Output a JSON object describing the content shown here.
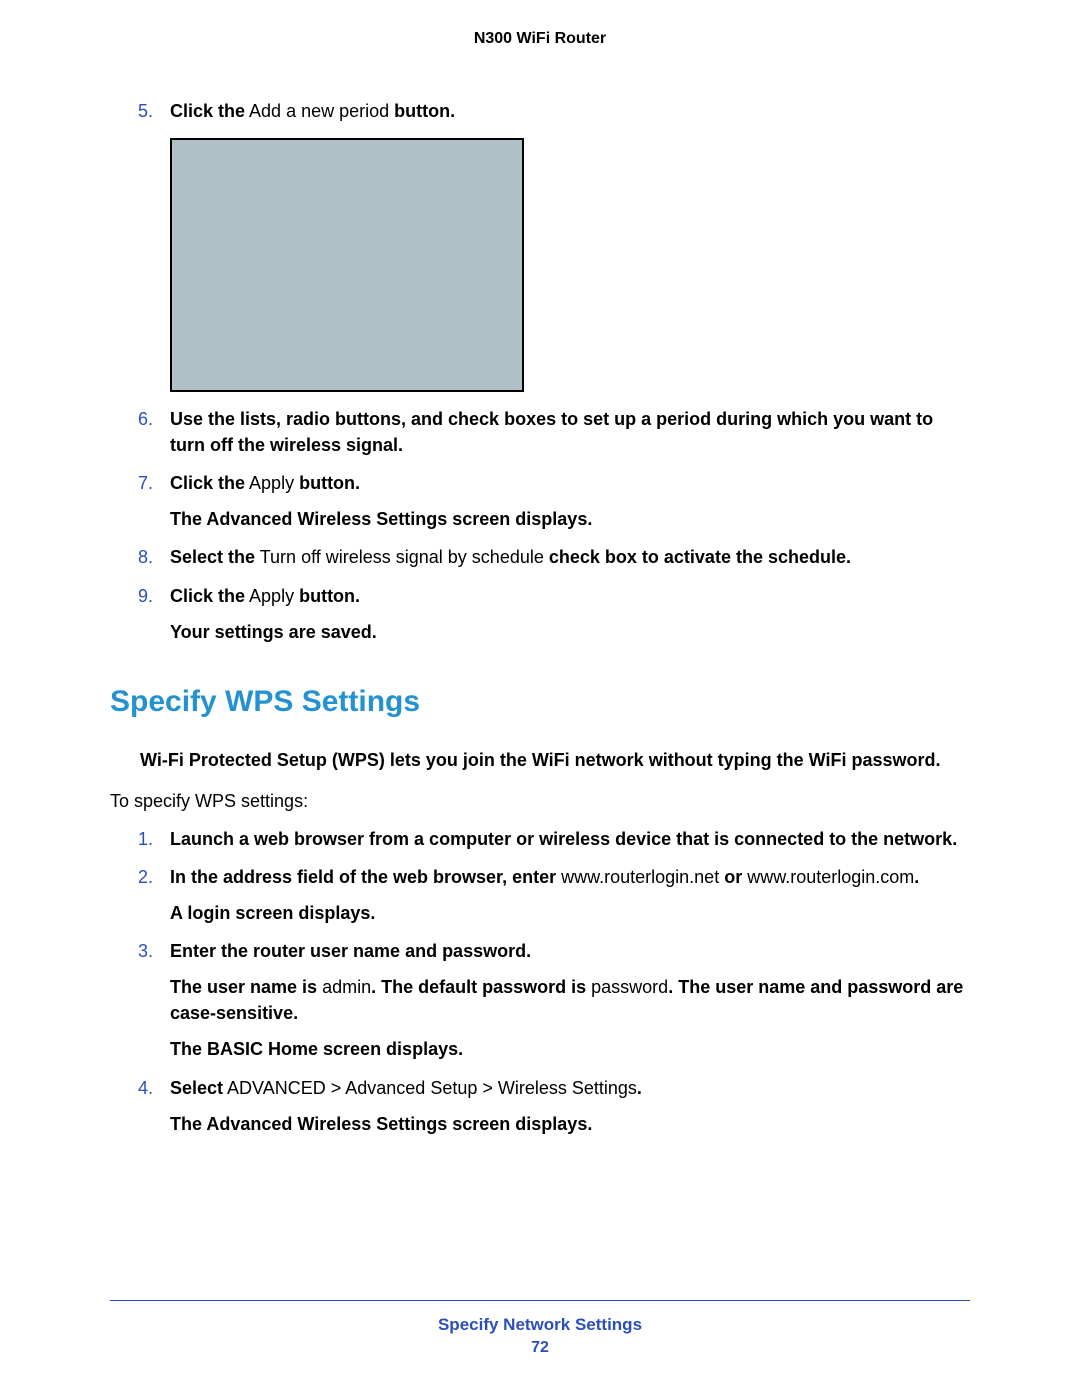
{
  "header": {
    "title": "N300 WiFi Router"
  },
  "section1": {
    "steps": {
      "s5": {
        "num": "5.",
        "b1": "Click the",
        "t1": " Add a new period ",
        "b2": "button."
      },
      "s6": {
        "num": "6.",
        "text": "Use the lists, radio buttons, and check boxes to set up a period during which you want to turn off the wireless signal."
      },
      "s7": {
        "num": "7.",
        "b1": "Click the",
        "t1": " Apply ",
        "b2": "button.",
        "sub": "The Advanced Wireless Settings screen displays."
      },
      "s8": {
        "num": "8.",
        "b1": "Select the",
        "t1": " Turn off wireless signal by schedule ",
        "b2": "check box to activate the schedule."
      },
      "s9": {
        "num": "9.",
        "b1": "Click the",
        "t1": " Apply ",
        "b2": "button.",
        "sub": "Your settings are saved."
      }
    }
  },
  "section2": {
    "heading": "Specify WPS Settings",
    "intro": "Wi-Fi Protected Setup (WPS) lets you join the WiFi network without typing the WiFi password.",
    "lead": "To specify WPS settings:",
    "steps": {
      "s1": {
        "num": "1.",
        "text": "Launch a web browser from a computer or wireless device that is connected to the network."
      },
      "s2": {
        "num": "2.",
        "b1": "In the address field of the web browser,",
        "b2": " enter ",
        "t1": "www.routerlogin.net",
        "b3": " or ",
        "t2": "www.routerlogin.com",
        "b4": ".",
        "sub": "A login screen displays."
      },
      "s3": {
        "num": "3.",
        "line1": "Enter the router user name and password.",
        "l2_b1": "The user name is",
        "l2_t1": " admin",
        "l2_b2": ". The default password is ",
        "l2_t2": "password",
        "l2_b3": ". ",
        "l2_b4": "The user name and password are case-sensitive.",
        "sub": "The BASIC Home screen displays."
      },
      "s4": {
        "num": "4.",
        "b1": "Select",
        "t1": " ADVANCED > Advanced Setup > Wireless Settings",
        "b2": ".",
        "sub": "The Advanced Wireless Settings screen displays."
      }
    }
  },
  "footer": {
    "title": "Specify Network Settings",
    "page": "72"
  }
}
